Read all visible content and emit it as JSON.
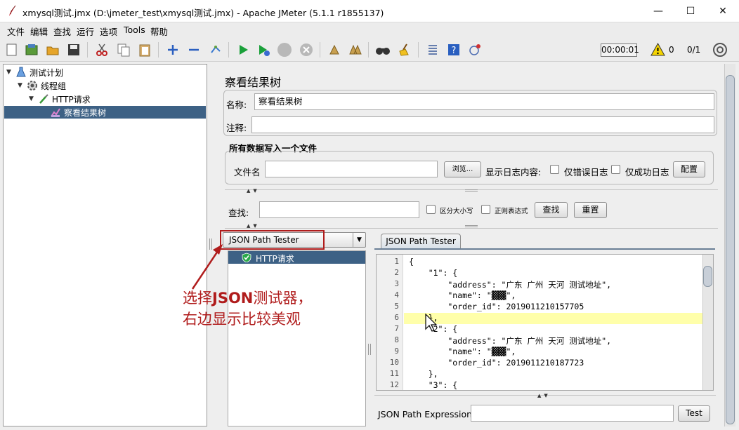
{
  "window": {
    "title": "xmysql测试.jmx (D:\\jmeter_test\\xmysql测试.jmx) - Apache JMeter (5.1.1 r1855137)",
    "minimize": "—",
    "maximize": "☐",
    "close": "✕"
  },
  "menu": {
    "items": [
      "文件",
      "编辑",
      "查找",
      "运行",
      "选项",
      "Tools",
      "帮助"
    ]
  },
  "toolbar": {
    "timer": "00:00:01",
    "warning_count": "0",
    "threads": "0/1"
  },
  "tree": {
    "nodes": [
      {
        "label": "测试计划",
        "icon": "flask-icon"
      },
      {
        "label": "线程组",
        "icon": "gear-icon"
      },
      {
        "label": "HTTP请求",
        "icon": "pipette-icon"
      },
      {
        "label": "察看结果树",
        "icon": "chart-icon"
      }
    ]
  },
  "panel": {
    "title": "察看结果树",
    "name_label": "名称:",
    "name_value": "察看结果树",
    "comment_label": "注释:",
    "comment_value": "",
    "write_all_label": "所有数据写入一个文件",
    "file_name_label": "文件名",
    "file_value": "",
    "browse_button": "浏览...",
    "log_content_label": "显示日志内容:",
    "errors_only": "仅错误日志",
    "success_only": "仅成功日志",
    "config_button": "配置",
    "search_label": "查找:",
    "search_value": "",
    "case_sensitive": "区分大小写",
    "regex": "正则表达式",
    "search_button": "查找",
    "reset_button": "重置"
  },
  "renderer": {
    "selected": "JSON Path Tester",
    "results": [
      "HTTP请求"
    ],
    "tab": "JSON Path Tester",
    "expression_label": "JSON Path Expression",
    "expression_value": "",
    "test_button": "Test"
  },
  "code": {
    "lines": [
      "{",
      "    \"1\": {",
      "        \"address\": \"广东 广州 天河 测试地址\",",
      "        \"name\": \"▓▓▓\",",
      "        \"order_id\": 2019011210157705",
      "    },",
      "    \"2\": {",
      "        \"address\": \"广东 广州 天河 测试地址\",",
      "        \"name\": \"▓▓▓\",",
      "        \"order_id\": 2019011210187723",
      "    },",
      "    \"3\": {"
    ],
    "highlighted_line": 6
  },
  "annotation": {
    "line1_prefix": "选择",
    "line1_bold": "JSON",
    "line1_suffix": "测试器，",
    "line2": "右边显示比较美观"
  },
  "colors": {
    "selection": "#3d6185",
    "annotation": "#b01c1c",
    "highlight": "#ffffaa"
  }
}
